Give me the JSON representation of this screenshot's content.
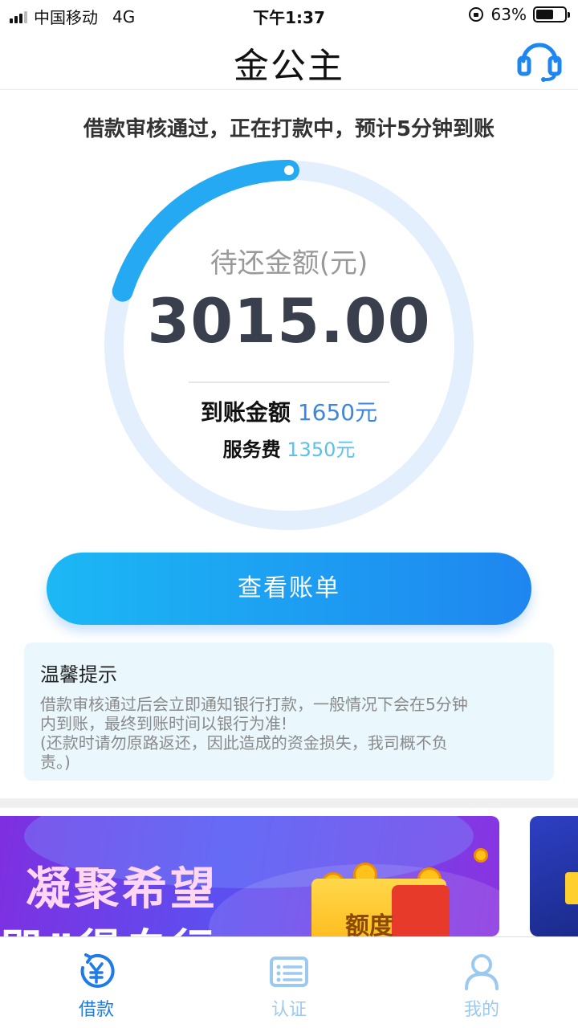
{
  "status_bar": {
    "carrier": "中国移动",
    "network": "4G",
    "time": "下午1:37",
    "battery_percent": "63%",
    "battery_level": 0.63
  },
  "nav": {
    "title": "金公主",
    "support_icon": "headset-icon"
  },
  "notice": "借款审核通过，正在打款中，预计5分钟到账",
  "ring": {
    "progress": 0.2,
    "label": "待还金额(元)",
    "amount": "3015.00",
    "received_label": "到账金额",
    "received_value": "1650元",
    "fee_label": "服务费",
    "fee_value": "1350元"
  },
  "bill_button": "查看账单",
  "tips": {
    "title": "温馨提示",
    "lines": [
      "借款审核通过后会立即通知银行打款，一般情况下会在5分钟",
      "内到账，最终到账时间以银行为准!",
      "(还款时请勿原路返还，因此造成的资金损失，我司概不负",
      "责。)"
    ]
  },
  "banner": {
    "title": "凝聚希望",
    "subtitle": "即”得白行",
    "quota": "额度"
  },
  "tabs": [
    {
      "label": "借款",
      "icon": "yuan-loan-icon",
      "active": true
    },
    {
      "label": "认证",
      "icon": "id-card-icon",
      "active": false
    },
    {
      "label": "我的",
      "icon": "user-icon",
      "active": false
    }
  ],
  "colors": {
    "primary": "#1e86f0",
    "accent_light": "#1cb8f4",
    "ring_track": "#e3effd",
    "amount_text": "#3a3f4d",
    "tips_bg": "#eaf7fd"
  }
}
